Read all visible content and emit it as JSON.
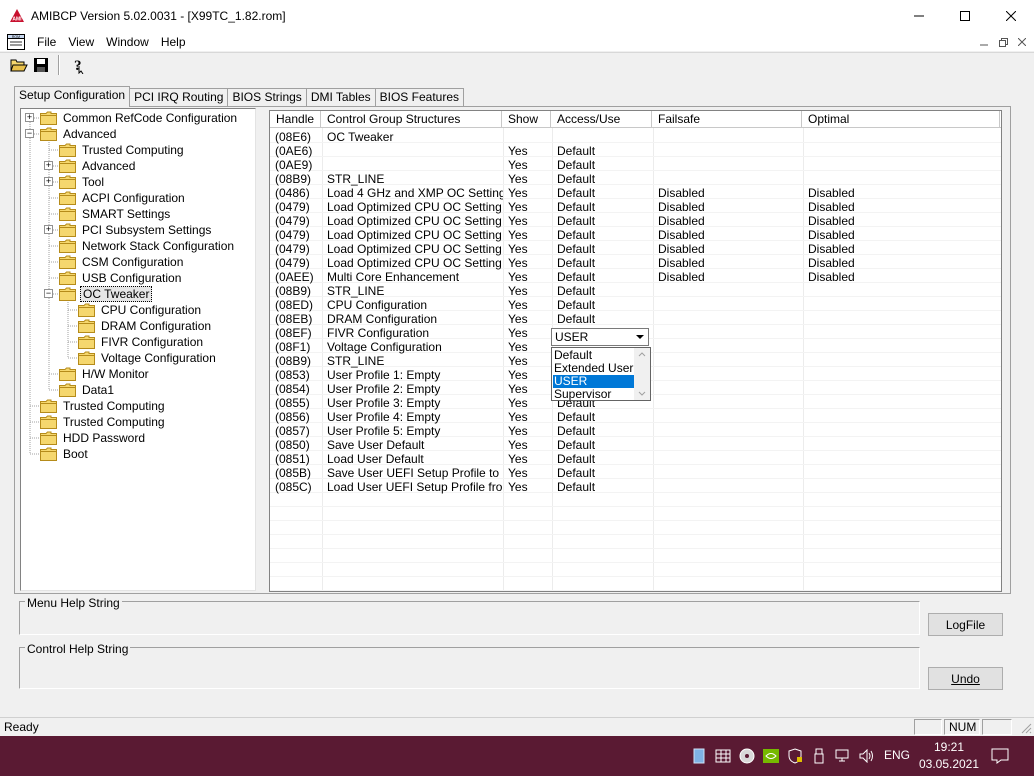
{
  "window": {
    "title": "AMIBCP Version 5.02.0031 - [X99TC_1.82.rom]"
  },
  "menu": [
    "File",
    "View",
    "Window",
    "Help"
  ],
  "tabs": [
    "Setup Configuration",
    "PCI IRQ Routing",
    "BIOS Strings",
    "DMI Tables",
    "BIOS Features"
  ],
  "tree": [
    {
      "label": "Common RefCode Configuration",
      "level": 0,
      "expander": "+"
    },
    {
      "label": "Advanced",
      "level": 0,
      "expander": "-"
    },
    {
      "label": "Trusted Computing",
      "level": 1,
      "expander": ""
    },
    {
      "label": "Advanced",
      "level": 1,
      "expander": "+"
    },
    {
      "label": "Tool",
      "level": 1,
      "expander": "+"
    },
    {
      "label": "ACPI Configuration",
      "level": 1,
      "expander": ""
    },
    {
      "label": "SMART Settings",
      "level": 1,
      "expander": ""
    },
    {
      "label": "PCI Subsystem Settings",
      "level": 1,
      "expander": "+"
    },
    {
      "label": "Network Stack Configuration",
      "level": 1,
      "expander": ""
    },
    {
      "label": "CSM Configuration",
      "level": 1,
      "expander": ""
    },
    {
      "label": "USB Configuration",
      "level": 1,
      "expander": ""
    },
    {
      "label": "OC Tweaker",
      "level": 1,
      "expander": "-",
      "selected": true
    },
    {
      "label": "CPU Configuration",
      "level": 2,
      "expander": ""
    },
    {
      "label": "DRAM Configuration",
      "level": 2,
      "expander": ""
    },
    {
      "label": "FIVR Configuration",
      "level": 2,
      "expander": ""
    },
    {
      "label": "Voltage Configuration",
      "level": 2,
      "expander": ""
    },
    {
      "label": "H/W Monitor",
      "level": 1,
      "expander": ""
    },
    {
      "label": "Data1",
      "level": 1,
      "expander": ""
    },
    {
      "label": "Trusted Computing",
      "level": 0,
      "expander": ""
    },
    {
      "label": "Trusted Computing",
      "level": 0,
      "expander": ""
    },
    {
      "label": "HDD Password",
      "level": 0,
      "expander": ""
    },
    {
      "label": "Boot",
      "level": 0,
      "expander": ""
    }
  ],
  "grid": {
    "columns": [
      "Handle",
      "Control Group Structures",
      "Show",
      "Access/Use",
      "Failsafe",
      "Optimal"
    ],
    "rows": [
      [
        "(08E6)",
        "OC Tweaker",
        "",
        "",
        "",
        ""
      ],
      [
        "(0AE6)",
        "",
        "Yes",
        "Default",
        "",
        ""
      ],
      [
        "(0AE9)",
        "",
        "Yes",
        "Default",
        "",
        ""
      ],
      [
        "(08B9)",
        "STR_LINE",
        "Yes",
        "Default",
        "",
        ""
      ],
      [
        "(0486)",
        "Load 4 GHz and XMP OC Setting",
        "Yes",
        "Default",
        "Disabled",
        "Disabled"
      ],
      [
        "(0479)",
        "Load Optimized CPU OC Setting",
        "Yes",
        "Default",
        "Disabled",
        "Disabled"
      ],
      [
        "(0479)",
        "Load Optimized CPU OC Setting",
        "Yes",
        "Default",
        "Disabled",
        "Disabled"
      ],
      [
        "(0479)",
        "Load Optimized CPU OC Setting",
        "Yes",
        "Default",
        "Disabled",
        "Disabled"
      ],
      [
        "(0479)",
        "Load Optimized CPU OC Setting",
        "Yes",
        "Default",
        "Disabled",
        "Disabled"
      ],
      [
        "(0479)",
        "Load Optimized CPU OC Setting",
        "Yes",
        "Default",
        "Disabled",
        "Disabled"
      ],
      [
        "(0AEE)",
        "Multi Core Enhancement",
        "Yes",
        "Default",
        "Disabled",
        "Disabled"
      ],
      [
        "(08B9)",
        "STR_LINE",
        "Yes",
        "Default",
        "",
        ""
      ],
      [
        "(08ED)",
        "CPU Configuration",
        "Yes",
        "Default",
        "",
        ""
      ],
      [
        "(08EB)",
        "DRAM Configuration",
        "Yes",
        "Default",
        "",
        ""
      ],
      [
        "(08EF)",
        "FIVR Configuration",
        "Yes",
        "",
        "",
        ""
      ],
      [
        "(08F1)",
        "Voltage Configuration",
        "Yes",
        "",
        "",
        ""
      ],
      [
        "(08B9)",
        "STR_LINE",
        "Yes",
        "",
        "",
        ""
      ],
      [
        "(0853)",
        "User Profile 1: Empty",
        "Yes",
        "",
        "",
        ""
      ],
      [
        "(0854)",
        "User Profile 2: Empty",
        "Yes",
        "",
        "",
        ""
      ],
      [
        "(0855)",
        "User Profile 3: Empty",
        "Yes",
        "Default",
        "",
        ""
      ],
      [
        "(0856)",
        "User Profile 4: Empty",
        "Yes",
        "Default",
        "",
        ""
      ],
      [
        "(0857)",
        "User Profile 5: Empty",
        "Yes",
        "Default",
        "",
        ""
      ],
      [
        "(0850)",
        "Save User Default",
        "Yes",
        "Default",
        "",
        ""
      ],
      [
        "(0851)",
        "Load User Default",
        "Yes",
        "Default",
        "",
        ""
      ],
      [
        "(085B)",
        "Save User UEFI Setup Profile to ...",
        "Yes",
        "Default",
        "",
        ""
      ],
      [
        "(085C)",
        "Load User UEFI Setup Profile fro...",
        "Yes",
        "Default",
        "",
        ""
      ]
    ]
  },
  "combo": {
    "value": "USER",
    "options": [
      "Default",
      "Extended User",
      "USER",
      "Supervisor"
    ],
    "selected": "USER"
  },
  "help": {
    "menu_label": "Menu Help String",
    "control_label": "Control Help String",
    "logfile_button": "LogFile",
    "undo_button": "Undo"
  },
  "status": {
    "text": "Ready",
    "num": "NUM"
  },
  "taskbar": {
    "lang": "ENG",
    "time": "19:21",
    "date": "03.05.2021"
  },
  "colors": {
    "taskbar": "#5a1a33",
    "selection": "#0078d7",
    "folder": "#f5d76e"
  }
}
